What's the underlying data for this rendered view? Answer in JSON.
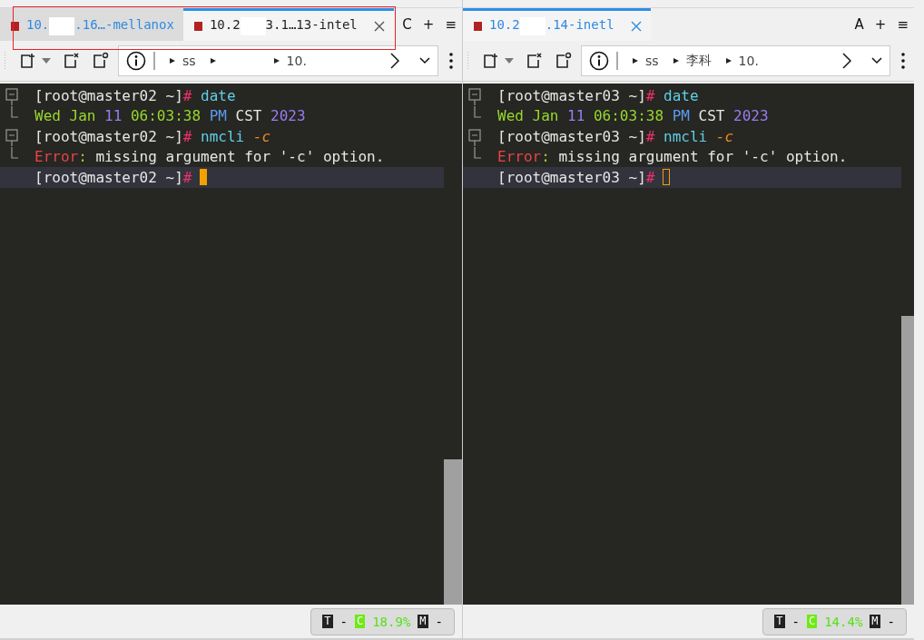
{
  "panes": [
    {
      "focused": true,
      "tabs": [
        {
          "parts": [
            "10.",
            ".16…-mellanox"
          ],
          "selected": false
        },
        {
          "parts": [
            "10.2",
            "3.1…13-intel"
          ],
          "selected": true
        }
      ],
      "tab_buttons": [
        "C",
        "+",
        "≡"
      ],
      "breadcrumbs": [
        {
          "text": "ss"
        },
        {
          "redacted": true
        },
        {
          "text": "10."
        }
      ],
      "lines": [
        {
          "kind": "fold-start",
          "segments": [
            {
              "t": "[root@master02 ~]",
              "kind": "plain"
            },
            {
              "t": "#",
              "kind": "hash"
            },
            {
              "t": " date",
              "kind": "command"
            }
          ]
        },
        {
          "kind": "fold-end",
          "segments": [
            {
              "t": "Wed Jan ",
              "kind": "green"
            },
            {
              "t": "11",
              "kind": "number"
            },
            {
              "t": " 06:03:38 ",
              "kind": "green"
            },
            {
              "t": "PM",
              "kind": "keyword"
            },
            {
              "t": " CST ",
              "kind": "plain"
            },
            {
              "t": "2023",
              "kind": "number"
            }
          ]
        },
        {
          "kind": "fold-start",
          "segments": [
            {
              "t": "[root@master02 ~]",
              "kind": "plain"
            },
            {
              "t": "#",
              "kind": "hash"
            },
            {
              "t": " nmcli ",
              "kind": "command"
            },
            {
              "t": "-c",
              "kind": "option"
            }
          ]
        },
        {
          "kind": "fold-end",
          "segments": [
            {
              "t": "Error",
              "kind": "error"
            },
            {
              "t": ":",
              "kind": "green"
            },
            {
              "t": " missing argument for '-c' option.",
              "kind": "plain"
            }
          ]
        },
        {
          "current": true,
          "segments": [
            {
              "t": "[root@master02 ~]",
              "kind": "plain"
            },
            {
              "t": "#",
              "kind": "hash"
            }
          ]
        }
      ],
      "status": {
        "t_label": "T",
        "t_value": "-",
        "c_label": "C",
        "c_value": "18.9%",
        "m_label": "M",
        "m_value": "-"
      }
    },
    {
      "focused": false,
      "tabs": [
        {
          "parts": [
            "10.2",
            ".14-inetl"
          ],
          "selected": true
        }
      ],
      "tab_buttons": [
        "A",
        "+",
        "≡"
      ],
      "breadcrumbs": [
        {
          "text": "ss"
        },
        {
          "text": "李科"
        },
        {
          "text": "10."
        }
      ],
      "lines": [
        {
          "kind": "fold-start",
          "segments": [
            {
              "t": "[root@master03 ~]",
              "kind": "plain"
            },
            {
              "t": "#",
              "kind": "hash"
            },
            {
              "t": " date",
              "kind": "command"
            }
          ]
        },
        {
          "kind": "fold-end",
          "segments": [
            {
              "t": "Wed Jan ",
              "kind": "green"
            },
            {
              "t": "11",
              "kind": "number"
            },
            {
              "t": " 06:03:38 ",
              "kind": "green"
            },
            {
              "t": "PM",
              "kind": "keyword"
            },
            {
              "t": " CST ",
              "kind": "plain"
            },
            {
              "t": "2023",
              "kind": "number"
            }
          ]
        },
        {
          "kind": "fold-start",
          "segments": [
            {
              "t": "[root@master03 ~]",
              "kind": "plain"
            },
            {
              "t": "#",
              "kind": "hash"
            },
            {
              "t": " nmcli ",
              "kind": "command"
            },
            {
              "t": "-c",
              "kind": "option"
            }
          ]
        },
        {
          "kind": "fold-end",
          "segments": [
            {
              "t": "Error",
              "kind": "error"
            },
            {
              "t": ":",
              "kind": "green"
            },
            {
              "t": " missing argument for '-c' option.",
              "kind": "plain"
            }
          ]
        },
        {
          "current": true,
          "segments": [
            {
              "t": "[root@master03 ~]",
              "kind": "plain"
            },
            {
              "t": "#",
              "kind": "hash"
            }
          ]
        }
      ],
      "status": {
        "t_label": "T",
        "t_value": "-",
        "c_label": "C",
        "c_value": "14.4%",
        "m_label": "M",
        "m_value": "-"
      }
    }
  ]
}
